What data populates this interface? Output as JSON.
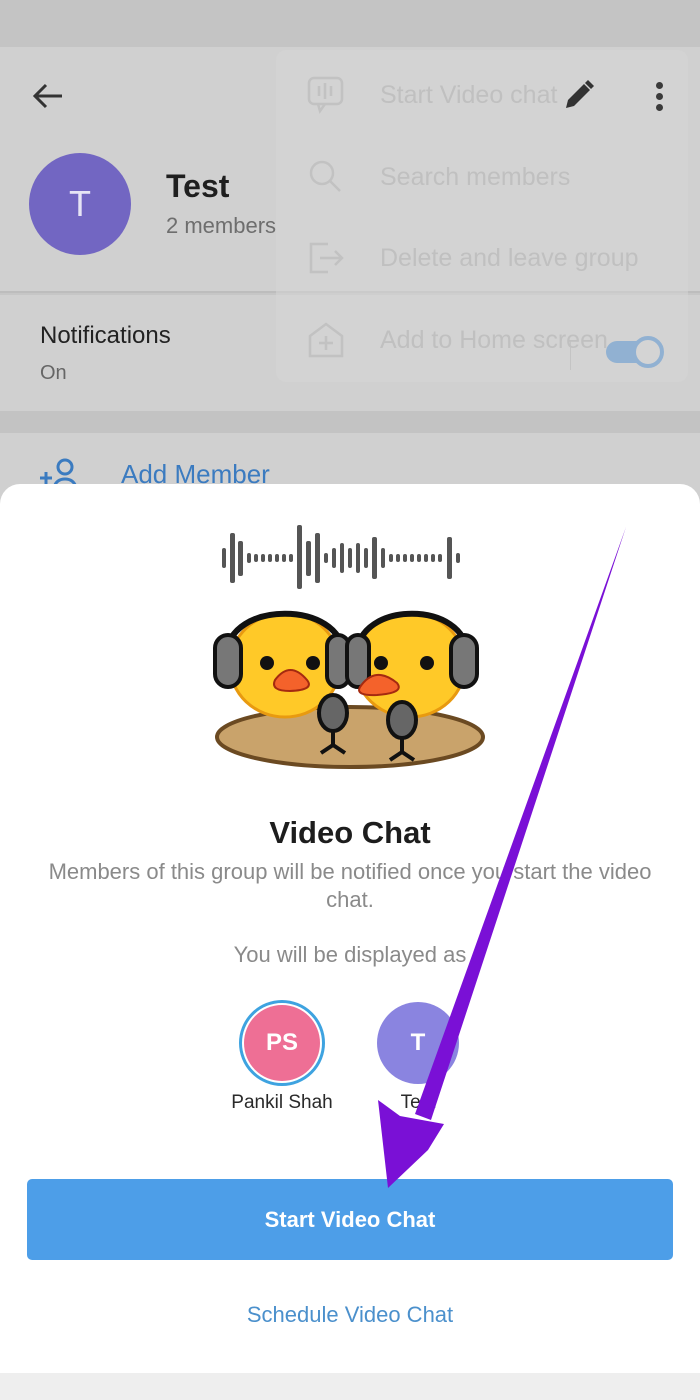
{
  "header": {
    "group_title": "Test",
    "group_subtitle": "2 members",
    "avatar_initial": "T",
    "back_icon": "arrow-left-icon",
    "edit_icon": "pencil-icon",
    "more_icon": "more-vertical-icon"
  },
  "menu": {
    "items": [
      {
        "label": "Start Video chat",
        "icon": "voice-chat-icon"
      },
      {
        "label": "Search members",
        "icon": "search-icon"
      },
      {
        "label": "Delete and leave group",
        "icon": "logout-icon"
      },
      {
        "label": "Add to Home screen",
        "icon": "add-home-icon"
      }
    ]
  },
  "notifications": {
    "title": "Notifications",
    "value": "On",
    "toggle_on": true
  },
  "add_member": {
    "label": "Add Member",
    "icon": "add-user-icon"
  },
  "sheet": {
    "illustration": "ducks-podcast-sticker",
    "title": "Video Chat",
    "description": "Members of this group will be notified once you start the video chat.",
    "display_as": "You will be displayed as",
    "accounts": [
      {
        "initials": "PS",
        "name": "Pankil Shah",
        "selected": true,
        "color": "#ee6f95"
      },
      {
        "initials": "T",
        "name": "Test",
        "selected": false,
        "color": "#8a84e0"
      }
    ],
    "primary_button": "Start Video Chat",
    "secondary_button": "Schedule Video Chat"
  },
  "colors": {
    "accent": "#4d9ee8",
    "link": "#4b90cc",
    "annotation_arrow": "#7a10d6"
  }
}
